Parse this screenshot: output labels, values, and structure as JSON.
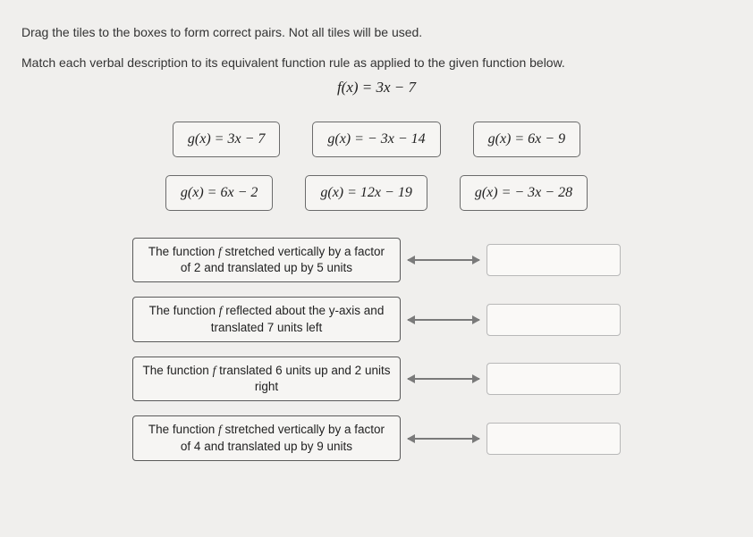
{
  "instruction": "Drag the tiles to the boxes to form correct pairs. Not all tiles will be used.",
  "prompt": "Match each verbal description to its equivalent function rule as applied to the given function below.",
  "given_function": "f(x)  =  3x  −  7",
  "tiles": {
    "row1": [
      "g(x)  =  3x  −  7",
      "g(x)  =   − 3x  −  14",
      "g(x)  =  6x  −  9"
    ],
    "row2": [
      "g(x)  =  6x  −  2",
      "g(x)  =  12x  −  19",
      "g(x)  =   − 3x  −  28"
    ]
  },
  "matches": [
    {
      "desc_pre": "The function ",
      "fname": "f",
      "desc_post": " stretched vertically by a factor of 2 and translated up by 5 units"
    },
    {
      "desc_pre": "The function ",
      "fname": "f",
      "desc_post": " reflected about the y-axis and translated 7 units left"
    },
    {
      "desc_pre": "The function ",
      "fname": "f",
      "desc_post": " translated 6 units up and 2 units right"
    },
    {
      "desc_pre": "The function ",
      "fname": "f",
      "desc_post": " stretched vertically by a factor of 4 and translated up by 9 units"
    }
  ]
}
